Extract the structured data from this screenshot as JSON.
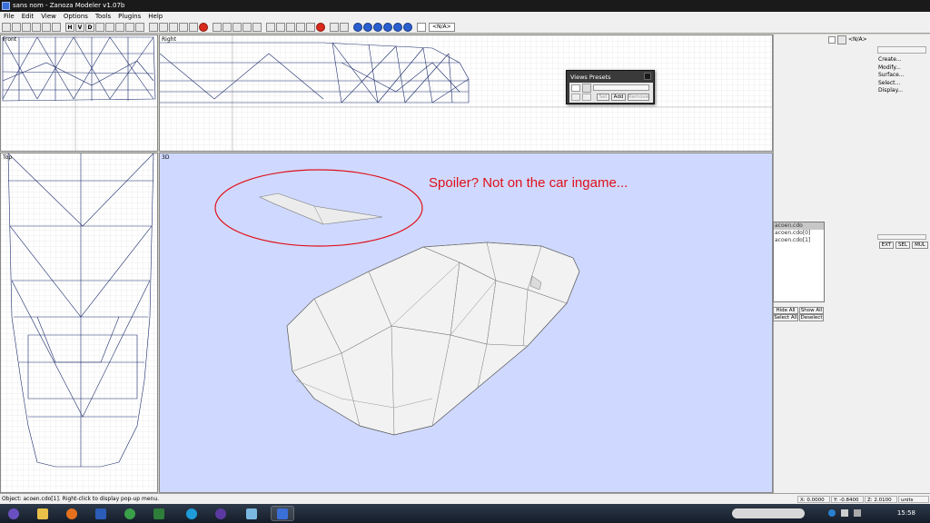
{
  "window": {
    "title": "sans nom - Zanoza Modeler v1.07b"
  },
  "menu": [
    "File",
    "Edit",
    "View",
    "Options",
    "Tools",
    "Plugins",
    "Help"
  ],
  "toolbar": {
    "letters": [
      "H",
      "V",
      "D"
    ],
    "na_label": "<N/A>"
  },
  "viewports": {
    "front": {
      "label": "Front"
    },
    "right": {
      "label": "Right"
    },
    "top": {
      "label": "Top"
    },
    "persp": {
      "label": "3D"
    }
  },
  "annotation": {
    "text": "Spoiler?  Not on the car ingame...",
    "color": "#e0101a"
  },
  "views_presets": {
    "title": "Views Presets",
    "set": "Set",
    "add": "Add",
    "remove": "Remove"
  },
  "right_panel": {
    "na_label": "<N/A>",
    "menu": [
      "Create...",
      "Modify...",
      "Surface...",
      "Select...",
      "Display..."
    ],
    "objects": [
      "acoen.cdo",
      "acoen.cdo[0]",
      "acoen.cdo[1]"
    ],
    "mode_buttons": [
      "EXT",
      "SEL",
      "MUL"
    ],
    "hide_all": "Hide All",
    "show_all": "Show All",
    "select_all": "Select All",
    "deselect": "Deselect"
  },
  "status": {
    "message": "Object: acoen.cdo[1]. Right-click to display pop-up menu.",
    "x": "X: 0.0000",
    "y": "Y: -0.8400",
    "z": "Z: 2.0100",
    "units": "units"
  },
  "taskbar": {
    "time": "15:58"
  },
  "colors": {
    "viewport3d_bg": "#cfd9ff",
    "wire": "#1a2a6a",
    "grid": "#d0d0d0"
  }
}
